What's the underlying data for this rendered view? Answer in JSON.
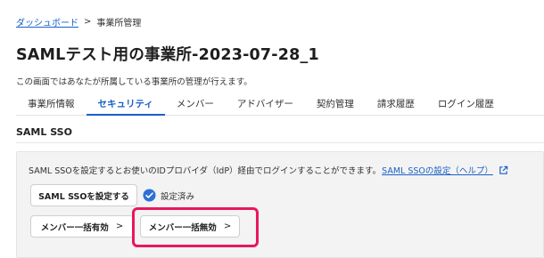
{
  "breadcrumb": {
    "home": "ダッシュボード",
    "separator": ">",
    "current": "事業所管理"
  },
  "page": {
    "title": "SAMLテスト用の事業所-2023-07-28_1",
    "description": "この画面ではあなたが所属している事業所の管理が行えます。"
  },
  "tabs": [
    {
      "label": "事業所情報",
      "active": false
    },
    {
      "label": "セキュリティ",
      "active": true
    },
    {
      "label": "メンバー",
      "active": false
    },
    {
      "label": "アドバイザー",
      "active": false
    },
    {
      "label": "契約管理",
      "active": false
    },
    {
      "label": "請求履歴",
      "active": false
    },
    {
      "label": "ログイン履歴",
      "active": false
    }
  ],
  "section": {
    "title": "SAML SSO"
  },
  "panel": {
    "text": "SAML SSOを設定するとお使いのIDプロバイダ（IdP）経由でログインすることができます。",
    "help_link": "SAML SSOの設定（ヘルプ）",
    "help_icon": "external-link-icon"
  },
  "buttons": {
    "setup": "SAML SSOを設定する",
    "enable_all": "メンバー一括有効",
    "disable_all": "メンバー一括無効",
    "chevron": ">"
  },
  "status": {
    "label": "設定済み",
    "icon": "check-circle-icon"
  },
  "colors": {
    "accent": "#1a5fc8",
    "highlight": "#e8175d",
    "panel_bg": "#f3f3f3"
  }
}
